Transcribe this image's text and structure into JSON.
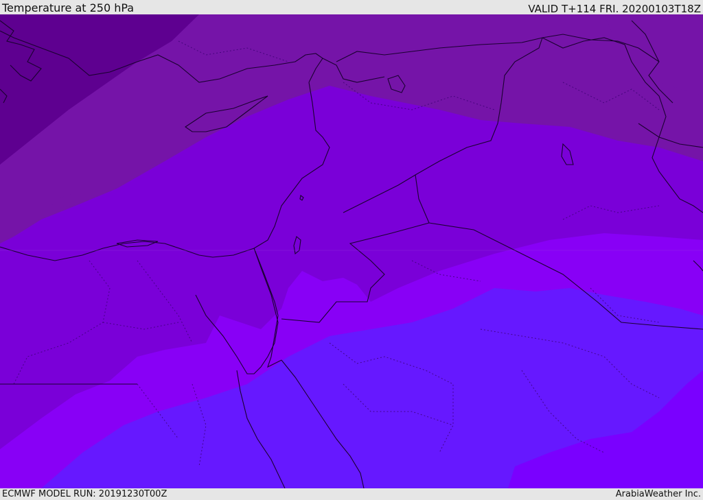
{
  "header": {
    "title": "Temperature at 250 hPa",
    "valid": "VALID T+114 FRI. 20200103T18Z"
  },
  "footer": {
    "model_run": "ECMWF MODEL RUN: 20191230T00Z",
    "credit": "ArabiaWeather Inc."
  },
  "colors": {
    "band_1": "#5e0090",
    "band_2": "#7514a8",
    "band_3": "#7a00d8",
    "band_4": "#8800f6",
    "band_5": "#6618ff",
    "band_6": "#7a00ff",
    "coastline": "#1a0030",
    "border": "#1a0030"
  }
}
